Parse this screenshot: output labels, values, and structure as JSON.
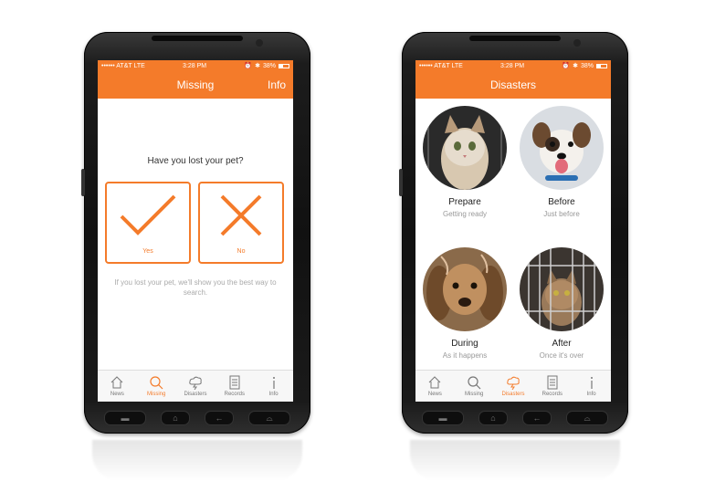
{
  "left": {
    "status": {
      "carrier": "•••••• AT&T  LTE",
      "time": "3:28 PM",
      "battery": "38%"
    },
    "nav": {
      "title": "Missing",
      "right": "Info"
    },
    "question": "Have you lost your pet?",
    "yes_label": "Yes",
    "no_label": "No",
    "hint": "If you lost your pet, we'll show you the best way to search.",
    "tabs": [
      {
        "label": "News",
        "icon": "home-icon"
      },
      {
        "label": "Missing",
        "icon": "search-icon",
        "active": true
      },
      {
        "label": "Disasters",
        "icon": "storm-icon"
      },
      {
        "label": "Records",
        "icon": "records-icon"
      },
      {
        "label": "Info",
        "icon": "info-icon"
      }
    ]
  },
  "right": {
    "status": {
      "carrier": "•••••• AT&T  LTE",
      "time": "3:28 PM",
      "battery": "38%"
    },
    "nav": {
      "title": "Disasters"
    },
    "items": [
      {
        "title": "Prepare",
        "subtitle": "Getting ready",
        "image": "kitten-in-crate"
      },
      {
        "title": "Before",
        "subtitle": "Just before",
        "image": "dog-with-tongue"
      },
      {
        "title": "During",
        "subtitle": "As it happens",
        "image": "wet-dog"
      },
      {
        "title": "After",
        "subtitle": "Once it's over",
        "image": "cat-in-cage"
      }
    ],
    "tabs": [
      {
        "label": "News",
        "icon": "home-icon"
      },
      {
        "label": "Missing",
        "icon": "search-icon"
      },
      {
        "label": "Disasters",
        "icon": "storm-icon",
        "active": true
      },
      {
        "label": "Records",
        "icon": "records-icon"
      },
      {
        "label": "Info",
        "icon": "info-icon"
      }
    ]
  },
  "colors": {
    "accent": "#f47b2a"
  }
}
